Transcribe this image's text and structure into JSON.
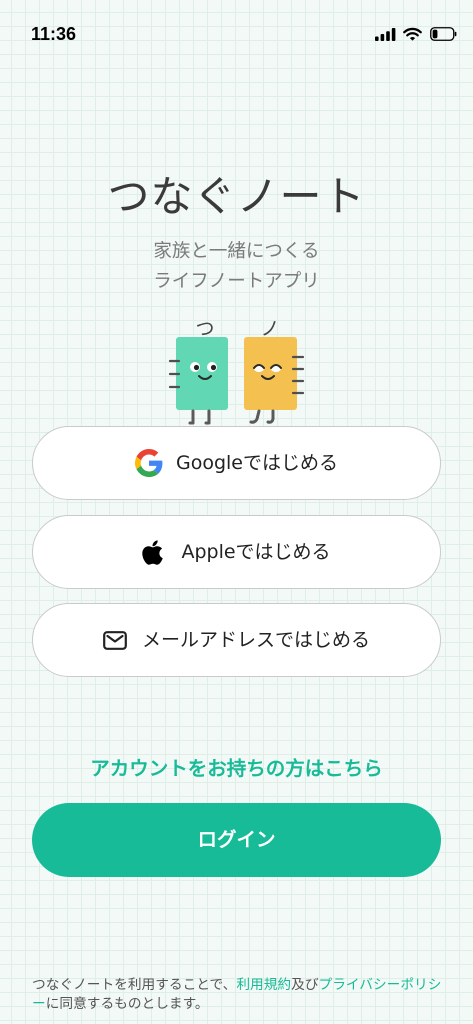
{
  "status_bar": {
    "time": "11:36",
    "battery_level": 0.25,
    "icons": [
      "signal-icon",
      "wifi-icon",
      "battery-icon"
    ]
  },
  "app": {
    "title": "つなぐノート",
    "tagline": [
      "家族と一緒につくる",
      "ライフノートアプリ"
    ]
  },
  "mascot": {
    "left_char": "つ",
    "right_char": "ノ"
  },
  "auth_buttons": [
    {
      "label": "Googleではじめる",
      "icon": "google-icon"
    },
    {
      "label": "Appleではじめる",
      "icon": "apple-icon"
    },
    {
      "label": "メールアドレスではじめる",
      "icon": "mail-icon"
    }
  ],
  "existing_account_link": "アカウントをお持ちの方はこちら",
  "login_button": "ログイン",
  "terms": {
    "prefix": "つなぐノートを利用することで、",
    "terms_link": "利用規約",
    "connector": "及び",
    "privacy_link": "プライバシーポリシー",
    "suffix": "に同意するものとします。"
  },
  "colors": {
    "accent": "#17bb97",
    "mascot_green": "#62d7b3",
    "mascot_yellow": "#f4c150",
    "background": "#f3f9f6"
  }
}
